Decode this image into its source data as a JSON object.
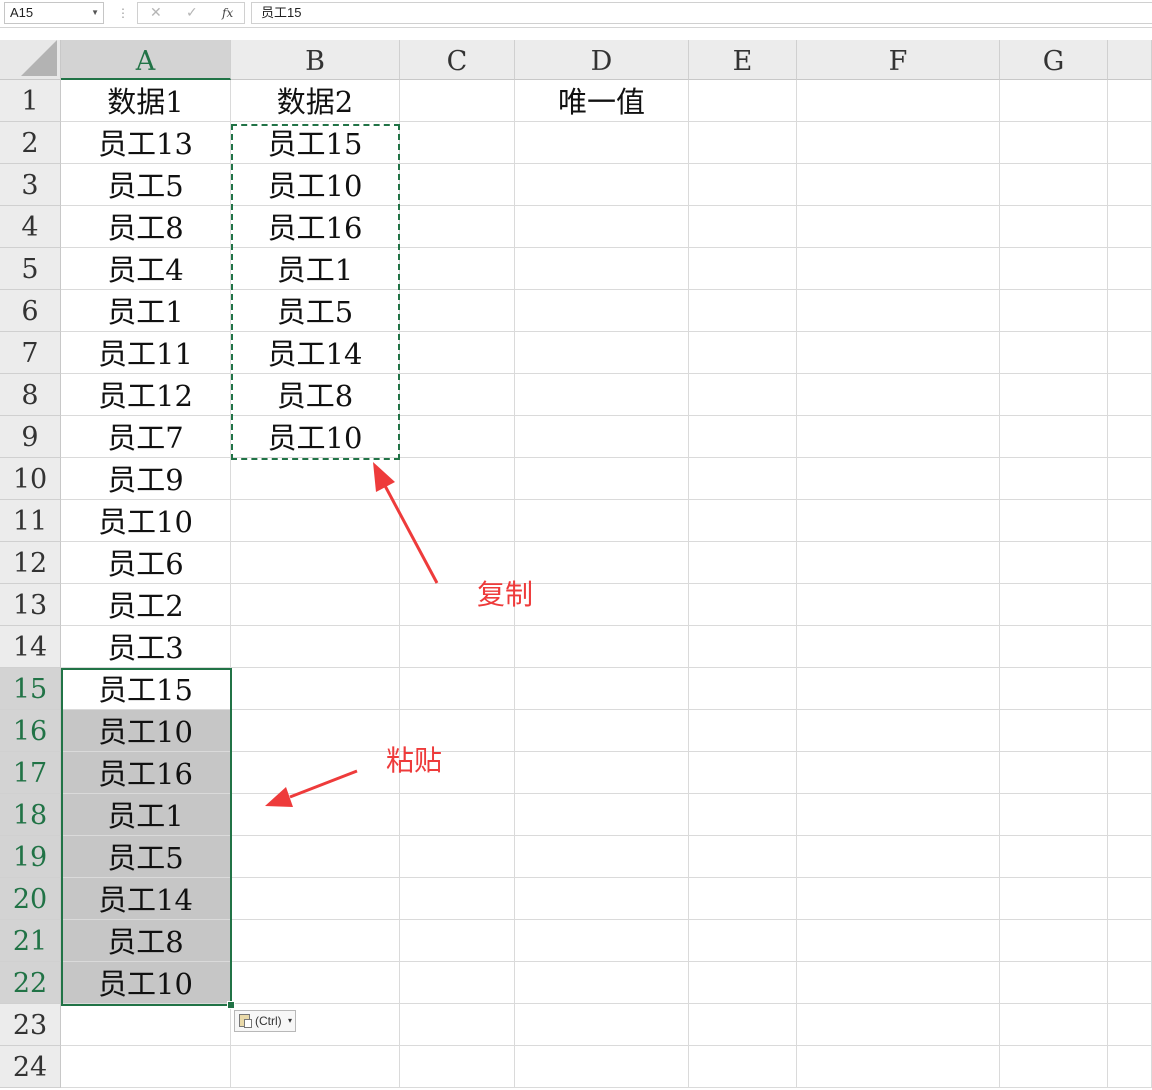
{
  "formula_bar": {
    "name_box": "A15",
    "separator": "⋮",
    "cancel_icon": "✕",
    "enter_icon": "✓",
    "fx_label": "fx",
    "formula": "员工15"
  },
  "columns": [
    "A",
    "B",
    "C",
    "D",
    "E",
    "F",
    "G"
  ],
  "selected_column": "A",
  "rows": [
    "1",
    "2",
    "3",
    "4",
    "5",
    "6",
    "7",
    "8",
    "9",
    "10",
    "11",
    "12",
    "13",
    "14",
    "15",
    "16",
    "17",
    "18",
    "19",
    "20",
    "21",
    "22",
    "23",
    "24"
  ],
  "selected_rows": [
    "15",
    "16",
    "17",
    "18",
    "19",
    "20",
    "21",
    "22"
  ],
  "cells": {
    "A": [
      "数据1",
      "员工13",
      "员工5",
      "员工8",
      "员工4",
      "员工1",
      "员工11",
      "员工12",
      "员工7",
      "员工9",
      "员工10",
      "员工6",
      "员工2",
      "员工3",
      "员工15",
      "员工10",
      "员工16",
      "员工1",
      "员工5",
      "员工14",
      "员工8",
      "员工10",
      "",
      ""
    ],
    "B": [
      "数据2",
      "员工15",
      "员工10",
      "员工16",
      "员工1",
      "员工5",
      "员工14",
      "员工8",
      "员工10",
      "",
      "",
      "",
      "",
      "",
      "",
      "",
      "",
      "",
      "",
      "",
      "",
      "",
      "",
      ""
    ],
    "D1": "唯一值"
  },
  "paste_options": {
    "label": "(Ctrl)",
    "dropdown_icon": "▾"
  },
  "annotations": {
    "copy": "复制",
    "paste": "粘贴",
    "color": "#ee3b3b"
  },
  "colors": {
    "excel_green": "#217346",
    "selection_fill": "#c6c6c6"
  }
}
